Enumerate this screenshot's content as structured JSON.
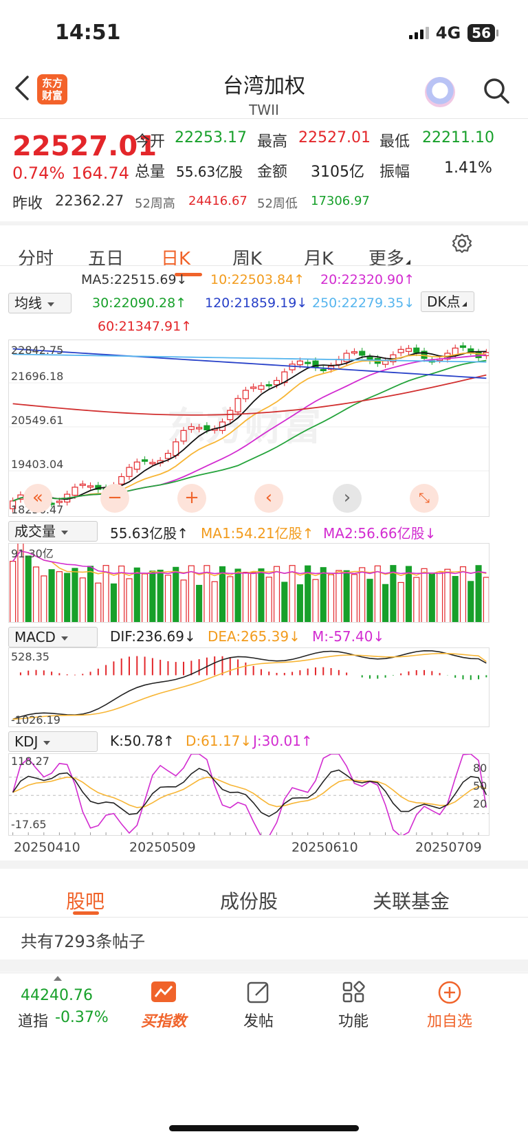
{
  "status_bar": {
    "time": "14:51",
    "network": "4G",
    "battery": "56"
  },
  "header": {
    "logo_text_1": "东方",
    "logo_text_2": "财富",
    "title": "台湾加权",
    "subtitle": "TWII"
  },
  "quote": {
    "price": "22527.01",
    "change_pct": "0.74%",
    "change": "164.74",
    "open_label": "今开",
    "open": "22253.17",
    "high_label": "最高",
    "high": "22527.01",
    "low_label": "最低",
    "low": "22211.10",
    "volume_label": "总量",
    "volume": "55.63亿股",
    "amount_label": "金额",
    "amount": "3105亿",
    "amplitude_label": "振幅",
    "amplitude": "1.41%",
    "prev_close_label": "昨收",
    "prev_close": "22362.27",
    "week52_high_label": "52周高",
    "week52_high": "24416.67",
    "week52_low_label": "52周低",
    "week52_low": "17306.97"
  },
  "tabs": [
    "分时",
    "五日",
    "日K",
    "周K",
    "月K",
    "更多"
  ],
  "active_tab": "日K",
  "ma_legend": {
    "ma5": "MA5:22515.69↓",
    "ma10": "10:22503.84↑",
    "ma20": "20:22320.90↑",
    "ma30": "30:22090.28↑",
    "ma120": "120:21859.19↓",
    "ma250": "250:22279.35↓",
    "ma60": "60:21347.91↑",
    "indicator_select": "均线",
    "dk_button": "DK点"
  },
  "price_axis": [
    "22842.75",
    "21696.18",
    "20549.61",
    "19403.04",
    "18256.47"
  ],
  "volume_panel": {
    "select": "成交量",
    "value": "55.63亿股↑",
    "ma1": "MA1:54.21亿股↑",
    "ma2": "MA2:56.66亿股↓",
    "axis_max": "91.30亿"
  },
  "macd_panel": {
    "select": "MACD",
    "dif": "DIF:236.69↓",
    "dea": "DEA:265.39↓",
    "m": "M:-57.40↓",
    "axis_max": "528.35",
    "axis_min": "-1026.19"
  },
  "kdj_panel": {
    "select": "KDJ",
    "k": "K:50.78↑",
    "d": "D:61.17↓",
    "j": "J:30.01↑",
    "axis_max": "118.27",
    "axis_min": "-17.65",
    "levels": [
      "80",
      "50",
      "20"
    ]
  },
  "date_axis": [
    "20250410",
    "20250509",
    "20250610",
    "20250709"
  ],
  "sub_tabs": [
    "股吧",
    "成份股",
    "关联基金"
  ],
  "posts_text": "共有7293条帖子",
  "bottom_bar": {
    "ticker_value": "44240.76",
    "ticker_name": "道指",
    "ticker_change": "-0.37%",
    "items": [
      "买指数",
      "发帖",
      "功能",
      "加自选"
    ]
  },
  "watermark": "东方财富",
  "colors": {
    "up": "#e3262a",
    "down": "#17a02a",
    "accent": "#f0632a"
  },
  "chart_data": {
    "type": "candlestick",
    "x_start": "20250410",
    "x_end": "20250711",
    "ylim": [
      18256.47,
      22842.75
    ],
    "ma_latest": {
      "MA5": 22515.69,
      "MA10": 22503.84,
      "MA20": 22320.9,
      "MA30": 22090.28,
      "MA60": 21347.91,
      "MA120": 21859.19,
      "MA250": 22279.35
    },
    "latest_close": 22527.01,
    "volume_latest": 55.63,
    "volume_max": 91.3
  }
}
